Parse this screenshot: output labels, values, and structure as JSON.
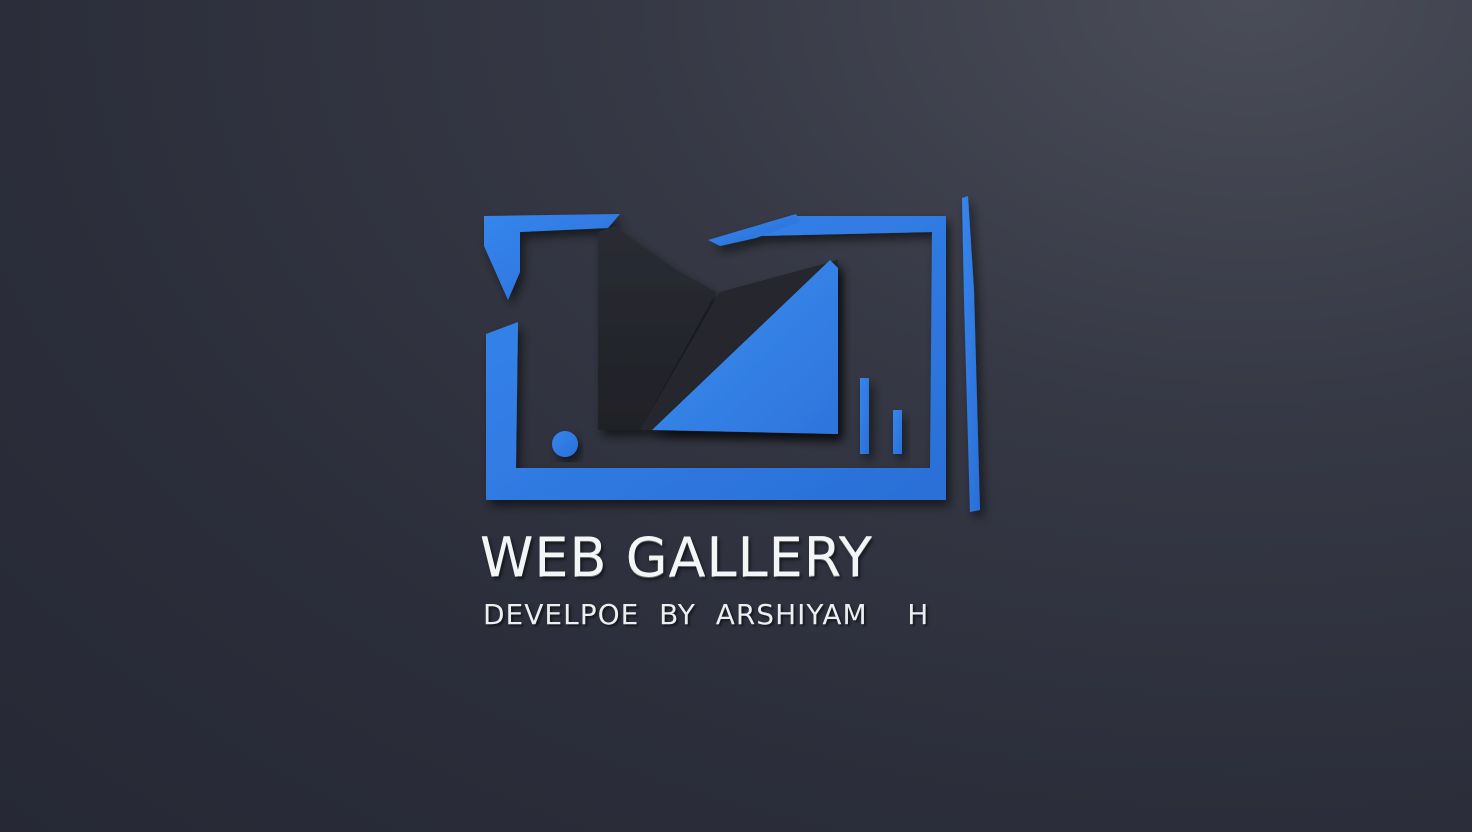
{
  "brand": {
    "title": "WEB GALLERY",
    "subtitle": "DEVELPOE  BY  ARSHIYAM    H"
  },
  "logo": {
    "icon": "image-gallery-frame-icon",
    "accent_color": "#2f7ae2",
    "dark_color": "#23252d"
  },
  "background_color": "#2d303c"
}
